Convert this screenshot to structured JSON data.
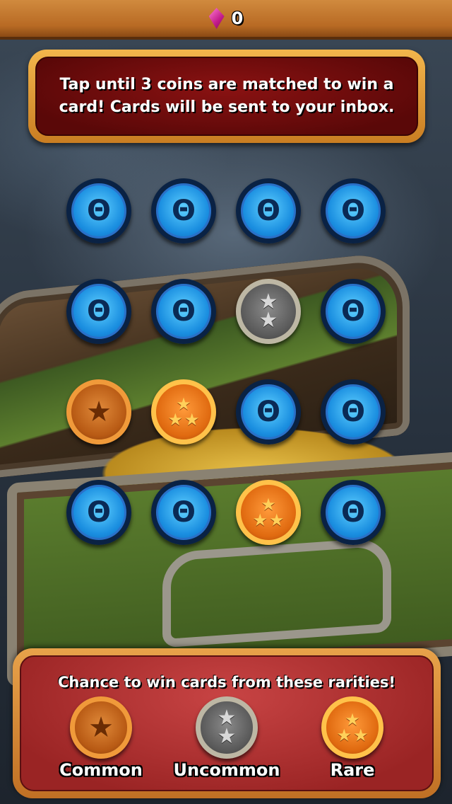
{
  "topbar": {
    "gem_count": "0",
    "gem_icon": "pink-gem-icon"
  },
  "banner": {
    "text": "Tap until 3 coins are matched to win a card! Cards will be sent to your inbox."
  },
  "grid": {
    "rows": [
      [
        "back",
        "back",
        "back",
        "back"
      ],
      [
        "back",
        "back",
        "uncommon",
        "back"
      ],
      [
        "common",
        "rare",
        "back",
        "back"
      ],
      [
        "back",
        "back",
        "rare",
        "back"
      ]
    ]
  },
  "panel": {
    "title": "Chance to win cards from these rarities!",
    "rarities": [
      {
        "key": "common",
        "label": "Common"
      },
      {
        "key": "uncommon",
        "label": "Uncommon"
      },
      {
        "key": "rare",
        "label": "Rare"
      }
    ]
  },
  "colors": {
    "coin_back": "#1a8ee0",
    "common": "#b85a14",
    "uncommon": "#5a5a5a",
    "rare": "#e06a10",
    "topbar": "#c07024",
    "banner": "#6a0c0c",
    "panel": "#b03030"
  }
}
